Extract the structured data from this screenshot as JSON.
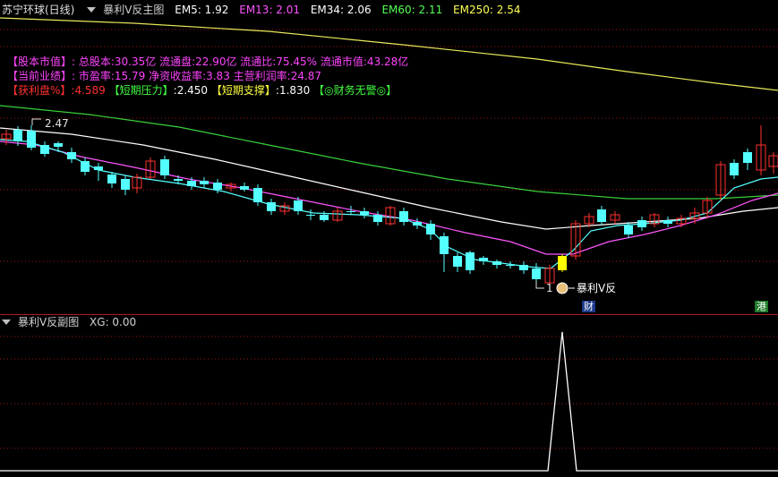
{
  "main": {
    "stock_title": "苏宁环球(日线)",
    "indicator_name": "暴利V反主图",
    "ema": [
      {
        "label": "EM5: 1.92",
        "color": "#ffffff"
      },
      {
        "label": "EM13: 2.01",
        "color": "#ff55ff"
      },
      {
        "label": "EM34: 2.06",
        "color": "#ffffff"
      },
      {
        "label": "EM60: 2.11",
        "color": "#55ff55"
      },
      {
        "label": "EM250: 2.54",
        "color": "#ffff55"
      }
    ],
    "info": {
      "line1": "【股本市值】: 总股本:30.35亿 流通盘:22.90亿 流通比:75.45% 流通市值:43.28亿",
      "line2": "【当前业绩】: 市盈率:15.79 净资收益率:3.83 主营利润率:24.87",
      "line3_a_label": "【获利盘%】",
      "line3_a_value": ":4.589",
      "line3_b_label": "【短期压力】",
      "line3_b_value": ":2.450",
      "line3_c_label": "【短期支撑】",
      "line3_c_value": ":1.830",
      "line3_d": "【◎财务无警◎】"
    },
    "high_label": "2.47",
    "low_label": "1",
    "signal_label": "暴利V反",
    "badge_cai": "财",
    "badge_gang": "港"
  },
  "sub": {
    "indicator_name": "暴利V反副图",
    "xg_label": "XG: 0.00"
  },
  "colors": {
    "up": "#ff3030",
    "down": "#54ffff",
    "ema5": "#ffffff",
    "ema13": "#ff55ff",
    "ema34": "#ffffff",
    "ema60": "#39d039",
    "ema250": "#e8e85a",
    "grid": "#a01418",
    "signal_candle": "#ffff00"
  },
  "chart_data": {
    "type": "candlestick",
    "series": [
      {
        "name": "EM5",
        "value": 1.92
      },
      {
        "name": "EM13",
        "value": 2.01
      },
      {
        "name": "EM34",
        "value": 2.06
      },
      {
        "name": "EM60",
        "value": 2.11
      },
      {
        "name": "EM250",
        "value": 2.54
      }
    ],
    "annotations": [
      "2.47",
      "1",
      "暴利V反"
    ],
    "sub_series": {
      "name": "XG",
      "value": 0.0
    }
  }
}
